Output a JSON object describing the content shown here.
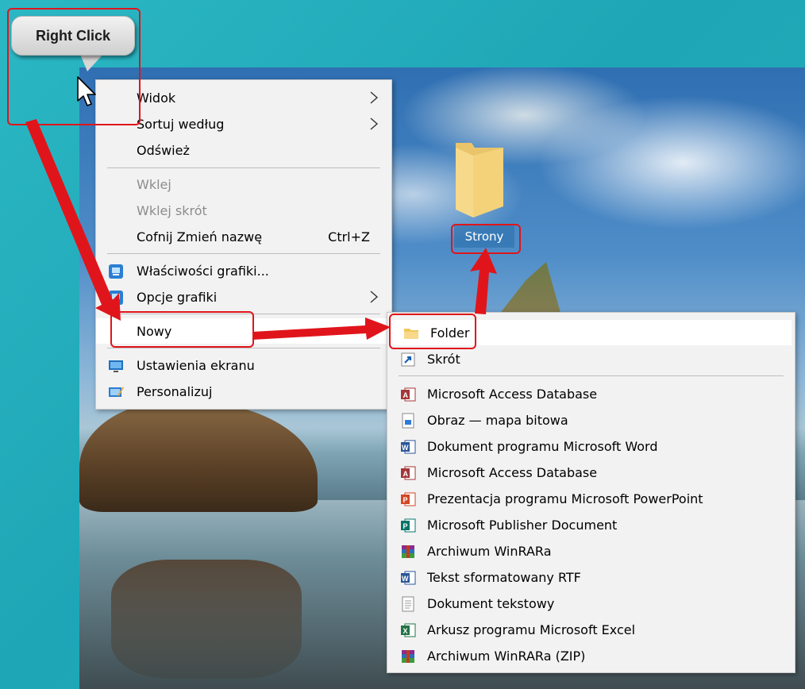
{
  "callout": {
    "text": "Right Click"
  },
  "desktop_icon": {
    "label": "Strony"
  },
  "context_menu": {
    "items": [
      {
        "label": "Widok",
        "submenu": true
      },
      {
        "label": "Sortuj według",
        "submenu": true
      },
      {
        "label": "Odśwież"
      },
      {
        "label": "Wklej",
        "disabled": true
      },
      {
        "label": "Wklej skrót",
        "disabled": true
      },
      {
        "label": "Cofnij Zmień nazwę",
        "shortcut": "Ctrl+Z"
      },
      {
        "label": "Właściwości grafiki...",
        "icon": "intel-graphics-icon"
      },
      {
        "label": "Opcje grafiki",
        "icon": "intel-graphics-icon",
        "submenu": true
      },
      {
        "label": "Nowy",
        "submenu": true,
        "highlighted": true
      },
      {
        "label": "Ustawienia ekranu",
        "icon": "display-settings-icon"
      },
      {
        "label": "Personalizuj",
        "icon": "personalize-icon"
      }
    ]
  },
  "new_submenu": {
    "items": [
      {
        "label": "Folder",
        "icon": "folder-icon",
        "highlighted": true
      },
      {
        "label": "Skrót",
        "icon": "shortcut-icon"
      },
      {
        "label": "Microsoft Access Database",
        "icon": "access-icon"
      },
      {
        "label": "Obraz — mapa bitowa",
        "icon": "bitmap-icon"
      },
      {
        "label": "Dokument programu Microsoft Word",
        "icon": "word-icon"
      },
      {
        "label": "Microsoft Access Database",
        "icon": "access-icon"
      },
      {
        "label": "Prezentacja programu Microsoft PowerPoint",
        "icon": "powerpoint-icon"
      },
      {
        "label": "Microsoft Publisher Document",
        "icon": "publisher-icon"
      },
      {
        "label": "Archiwum WinRARa",
        "icon": "winrar-icon"
      },
      {
        "label": "Tekst sformatowany RTF",
        "icon": "rtf-icon"
      },
      {
        "label": "Dokument tekstowy",
        "icon": "text-document-icon"
      },
      {
        "label": "Arkusz programu Microsoft Excel",
        "icon": "excel-icon"
      },
      {
        "label": "Archiwum WinRARa (ZIP)",
        "icon": "winrar-icon"
      }
    ]
  },
  "colors": {
    "annotation_red": "#e0151b",
    "menu_bg": "#f2f2f2",
    "desktop_teal": "#23aebd"
  }
}
